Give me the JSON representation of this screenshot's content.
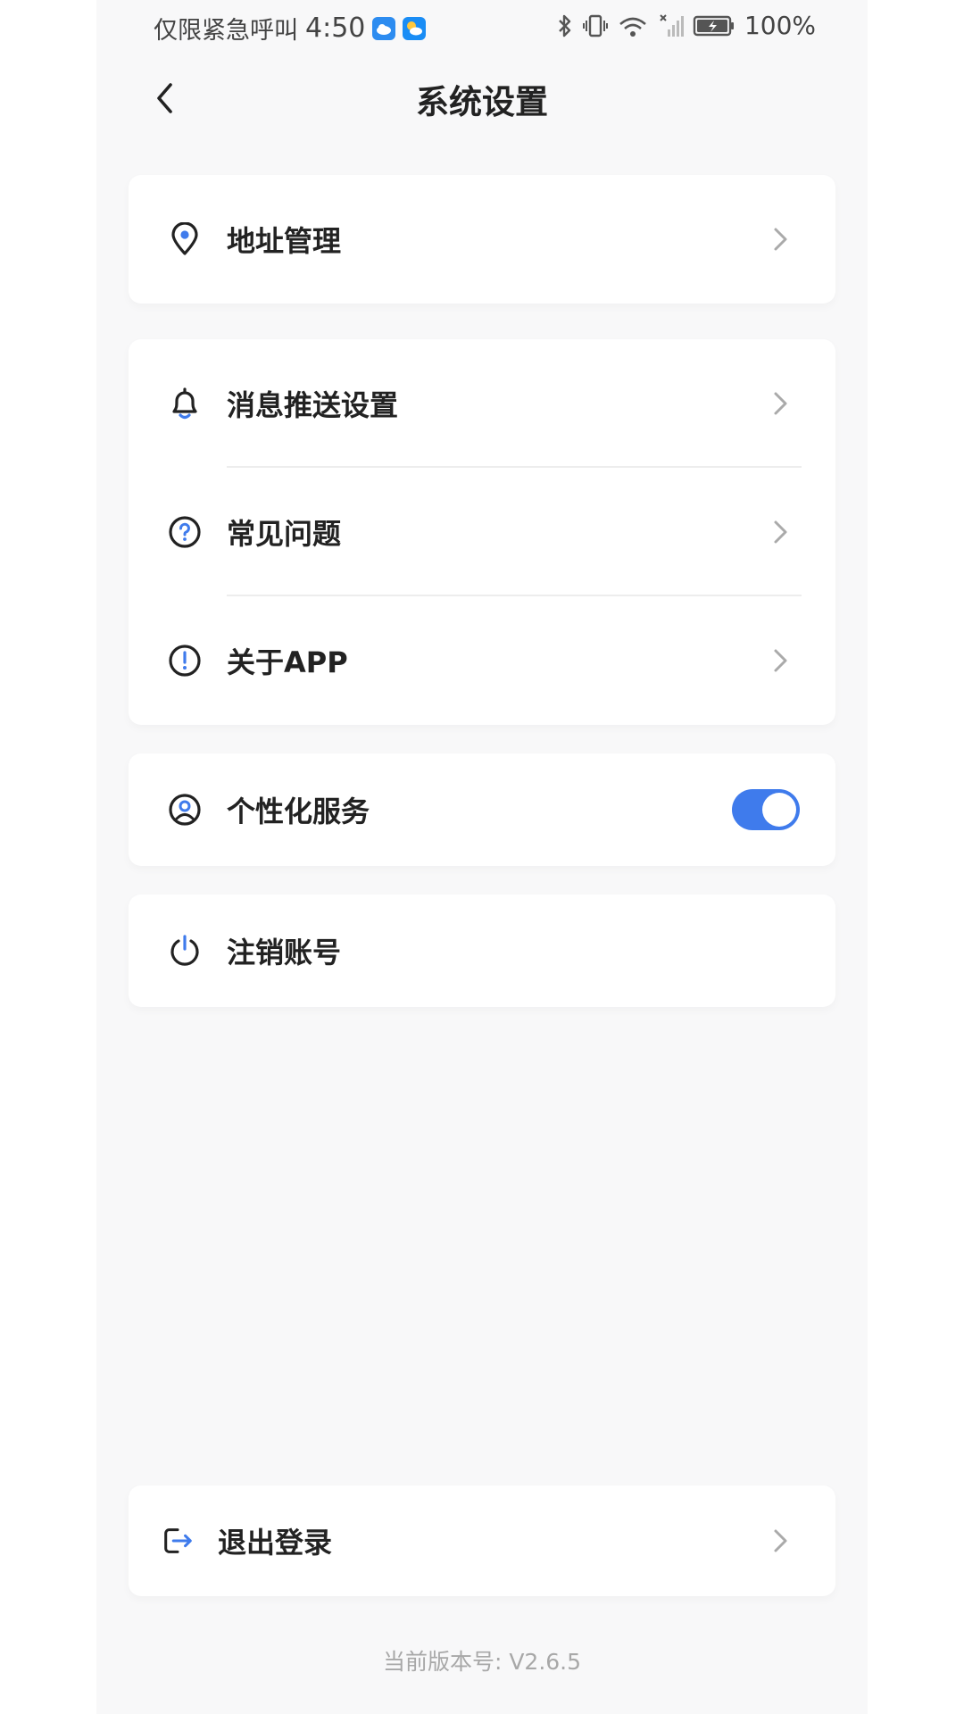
{
  "status_bar": {
    "carrier": "仅限紧急呼叫",
    "time": "4:50",
    "battery": "100%"
  },
  "header": {
    "title": "系统设置"
  },
  "groups": [
    {
      "items": [
        {
          "label": "地址管理",
          "icon": "location-icon"
        }
      ]
    },
    {
      "items": [
        {
          "label": "消息推送设置",
          "icon": "bell-icon"
        },
        {
          "label": "常见问题",
          "icon": "question-icon"
        },
        {
          "label": "关于APP",
          "icon": "info-icon"
        }
      ]
    },
    {
      "items": [
        {
          "label": "个性化服务",
          "icon": "user-circle-icon",
          "toggle": true
        }
      ]
    },
    {
      "items": [
        {
          "label": "注销账号",
          "icon": "power-icon"
        }
      ]
    }
  ],
  "logout": {
    "label": "退出登录",
    "icon": "logout-icon"
  },
  "version_text": "当前版本号: V2.6.5",
  "colors": {
    "accent": "#3f7bec",
    "background": "#f8f8f9",
    "text": "#222222",
    "muted": "#a8a8a8"
  }
}
